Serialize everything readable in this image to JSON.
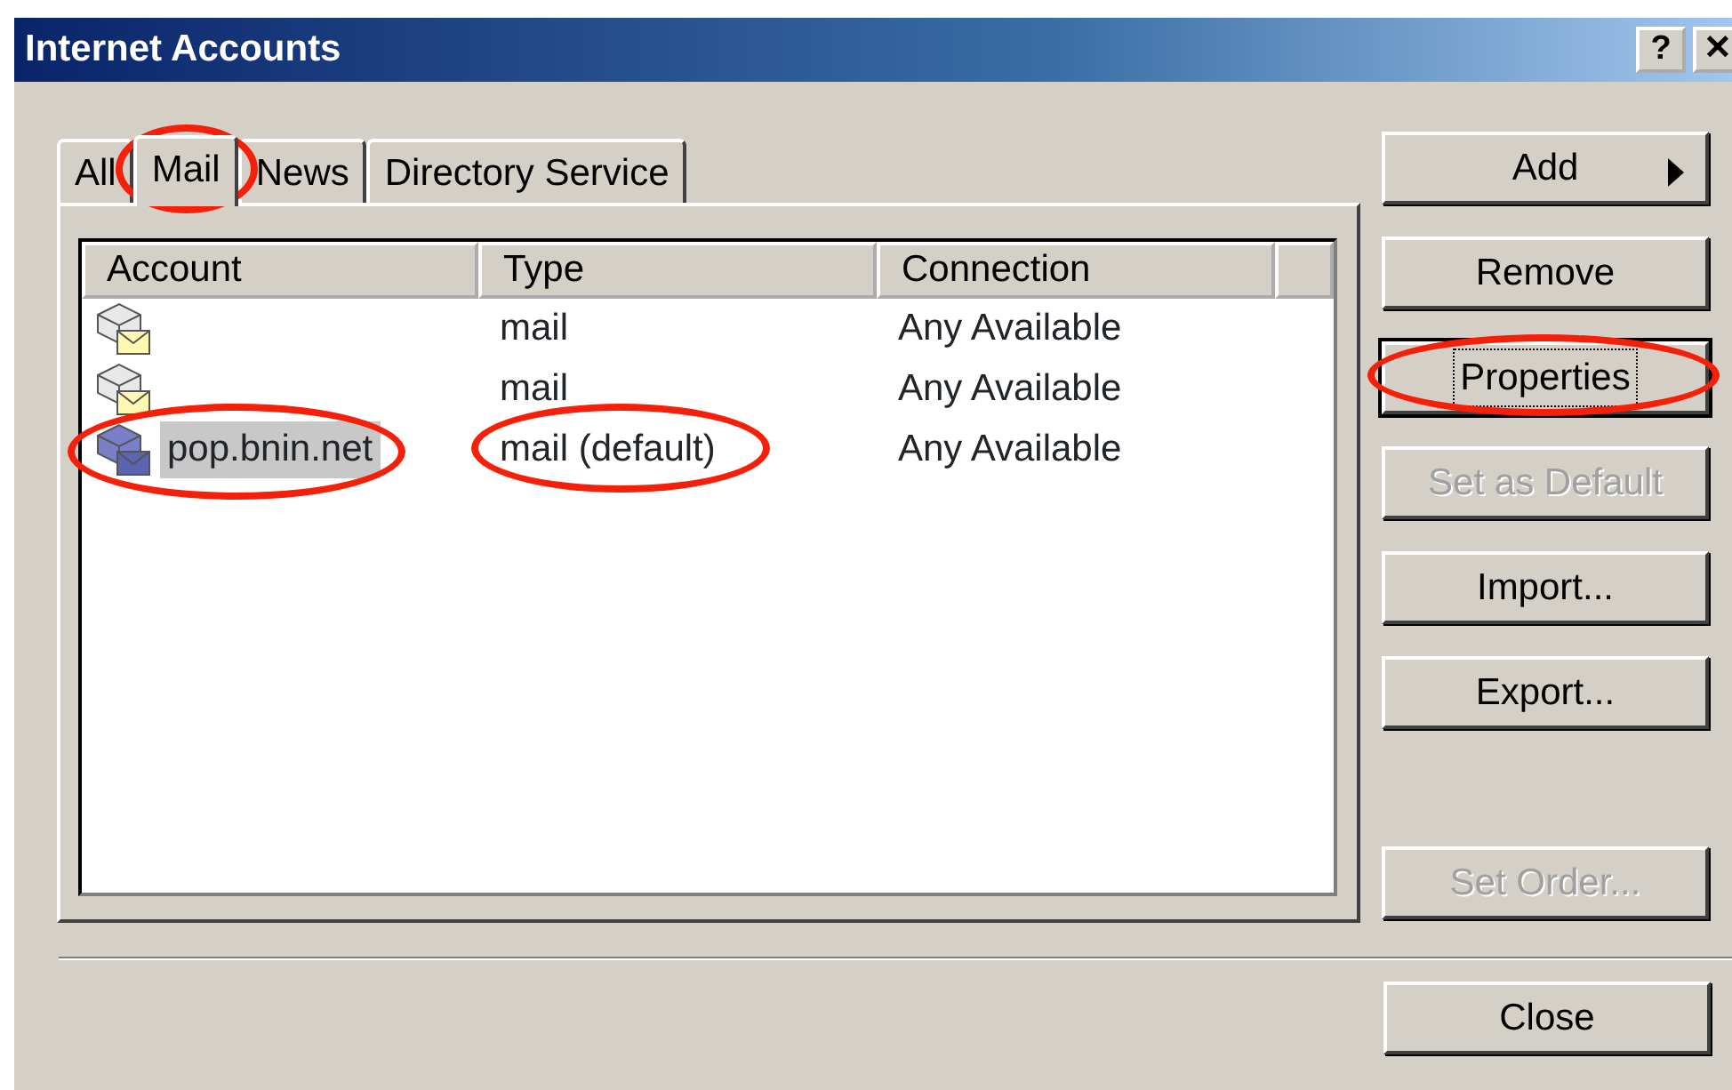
{
  "window": {
    "title": "Internet Accounts",
    "title_buttons": [
      "?",
      "✕"
    ]
  },
  "tabs": [
    {
      "label": "All",
      "selected": false,
      "circled": false
    },
    {
      "label": "Mail",
      "selected": true,
      "circled": true
    },
    {
      "label": "News",
      "selected": false,
      "circled": false
    },
    {
      "label": "Directory Service",
      "selected": false,
      "circled": false
    }
  ],
  "table": {
    "columns": [
      "Account",
      "Type",
      "Connection"
    ],
    "rows": [
      {
        "account": "",
        "type": "mail",
        "connection": "Any Available",
        "selected": false,
        "circled": false
      },
      {
        "account": "",
        "type": "mail",
        "connection": "Any Available",
        "selected": false,
        "circled": false
      },
      {
        "account": "pop.bnin.net",
        "type": "mail (default)",
        "connection": "Any Available",
        "selected": true,
        "circled": true
      }
    ]
  },
  "buttons": [
    {
      "label": "Add",
      "disabled": false,
      "arrow": true,
      "focused": false,
      "circled": false
    },
    {
      "label": "Remove",
      "disabled": false,
      "arrow": false,
      "focused": false,
      "circled": false
    },
    {
      "label": "Properties",
      "disabled": false,
      "arrow": false,
      "focused": true,
      "circled": true
    },
    {
      "label": "Set as Default",
      "disabled": true,
      "arrow": false,
      "focused": false,
      "circled": false
    },
    {
      "label": "Import...",
      "disabled": false,
      "arrow": false,
      "focused": false,
      "circled": false
    },
    {
      "label": "Export...",
      "disabled": false,
      "arrow": false,
      "focused": false,
      "circled": false
    },
    {
      "label": "Set Order...",
      "disabled": true,
      "arrow": false,
      "focused": false,
      "circled": false
    }
  ],
  "footer_buttons": [
    {
      "label": "Close"
    }
  ]
}
